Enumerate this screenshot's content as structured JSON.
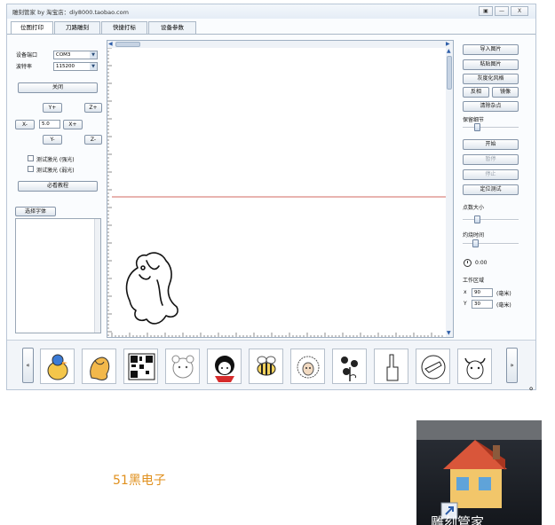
{
  "window": {
    "title": "雕刻管家 by 淘宝店：diy8000.taobao.com",
    "controls": [
      "▣",
      "—",
      "X"
    ]
  },
  "tabs": [
    {
      "label": "位图打印",
      "active": true
    },
    {
      "label": "刀路雕刻",
      "active": false
    },
    {
      "label": "快捷打标",
      "active": false
    },
    {
      "label": "设备参数",
      "active": false
    }
  ],
  "left_panel": {
    "port_label": "设备端口",
    "port_value": "COM3",
    "baud_label": "波特率",
    "baud_value": "115200",
    "close_button": "关闭",
    "y_plus": "Y+",
    "z_plus": "Z+",
    "x_minus": "X-",
    "step_value": "5.0",
    "x_plus": "X+",
    "y_minus": "Y-",
    "z_minus": "Z-",
    "test_laser_strong": "测试激光 (强光)",
    "test_laser_weak": "测试激光 (弱光)",
    "tutorial_button": "必看教程",
    "font_button": "选择字体"
  },
  "right_panel": {
    "import_image": "导入图片",
    "paste_image": "粘贴图片",
    "grayscale": "灰度化风格",
    "invert": "反相",
    "mirror": "镜像",
    "clear_noise": "清除杂点",
    "keep_detail": "保留细节",
    "start": "开始",
    "pause": "暂停",
    "stop": "停止",
    "locate_test": "定位测试",
    "dot_size": "点数大小",
    "burn_time": "灼烧时间",
    "timer": "0:00",
    "work_area": "工作区域",
    "x_label": "x",
    "x_value": "90",
    "y_label": "Y",
    "y_value": "30",
    "unit": "(毫米)"
  },
  "gallery": {
    "prev": "«",
    "next": "»",
    "items": [
      "duck",
      "horse",
      "qr-code",
      "bear",
      "girl",
      "bee",
      "sheep",
      "flowers",
      "middle-finger",
      "pointing-hand",
      "bull"
    ]
  },
  "trailing_mark": "。",
  "footer_text": "51黑电子",
  "desktop_icon": {
    "label": "雕刻管家"
  },
  "colors": {
    "red_line": "#c0392b",
    "footer_orange": "#e0901e"
  }
}
